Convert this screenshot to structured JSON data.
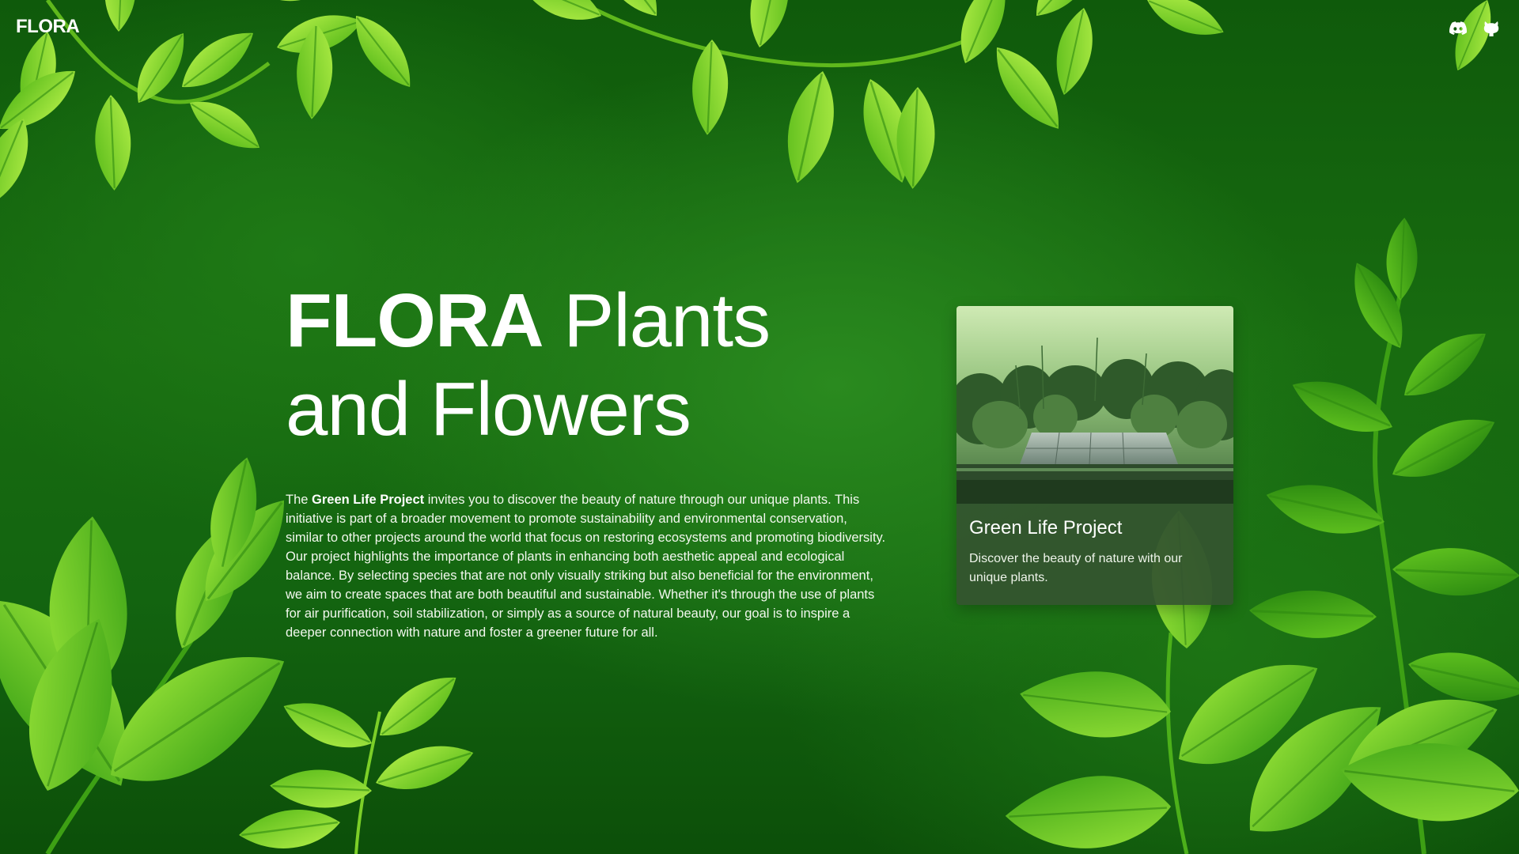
{
  "header": {
    "logo": "FLORA",
    "icons": [
      {
        "name": "discord-icon"
      },
      {
        "name": "github-icon"
      }
    ]
  },
  "hero": {
    "title_bold": "FLORA",
    "title_line1_rest": " Plants",
    "title_line2": "and Flowers",
    "desc_prefix": "The ",
    "desc_bold": "Green Life Project",
    "desc_rest": " invites you to discover the beauty of nature through our unique plants. This initiative is part of a broader movement to promote sustainability and environmental conservation, similar to other projects around the world that focus on restoring ecosystems and promoting biodiversity. Our project highlights the importance of plants in enhancing both aesthetic appeal and ecological balance. By selecting species that are not only visually striking but also beneficial for the environment, we aim to create spaces that are both beautiful and sustainable. Whether it's through the use of plants for air purification, soil stabilization, or simply as a source of natural beauty, our goal is to inspire a deeper connection with nature and foster a greener future for all."
  },
  "card": {
    "title": "Green Life Project",
    "text": "Discover the beauty of nature with our unique plants."
  },
  "colors": {
    "background": "#186c10",
    "leaf_light": "#8fe02a",
    "leaf_mid": "#4db818",
    "card_bg": "#345430",
    "text": "#ffffff"
  }
}
